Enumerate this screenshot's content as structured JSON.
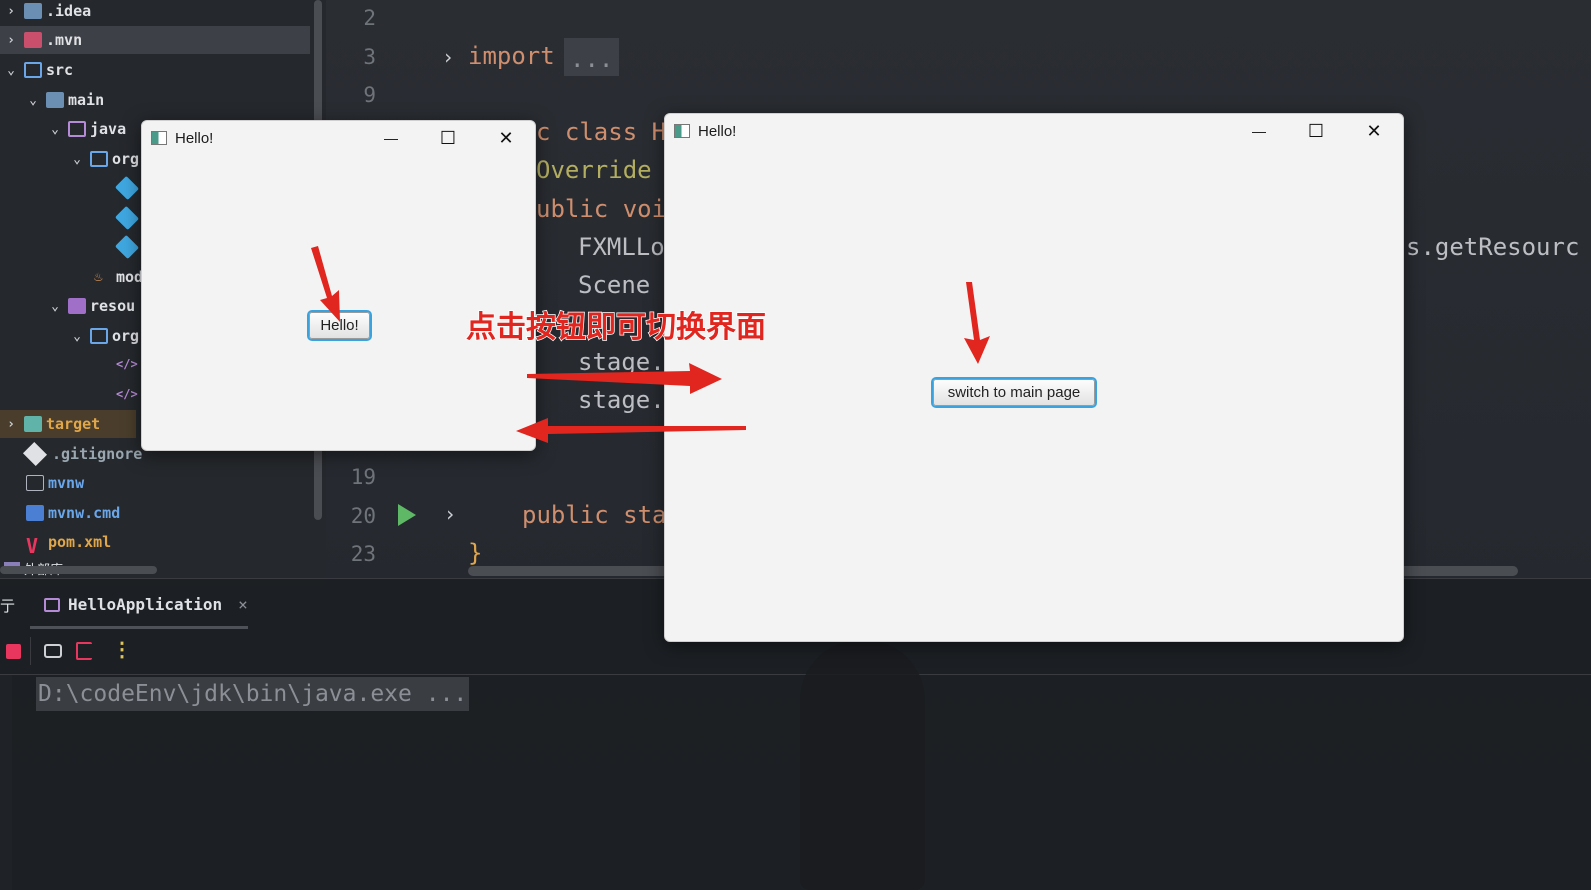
{
  "project_tree": {
    "items": [
      {
        "label": ".idea",
        "icon": "idea-folder-icon",
        "chevron": "›"
      },
      {
        "label": ".mvn",
        "icon": "mvn-folder-icon",
        "chevron": "›"
      },
      {
        "label": "src",
        "icon": "source-folder-icon",
        "chevron": "⌄"
      },
      {
        "label": "main",
        "icon": "folder-icon",
        "chevron": "⌄"
      },
      {
        "label": "java",
        "icon": "java-source-folder-icon",
        "chevron": "⌄"
      },
      {
        "label": "org",
        "icon": "package-icon",
        "chevron": "⌄"
      },
      {
        "label": "",
        "icon": "java-class-icon",
        "chevron": ""
      },
      {
        "label": "",
        "icon": "java-class-icon",
        "chevron": ""
      },
      {
        "label": "",
        "icon": "java-class-icon",
        "chevron": ""
      },
      {
        "label": "mod",
        "icon": "module-info-icon",
        "chevron": ""
      },
      {
        "label": "resou",
        "icon": "resources-folder-icon",
        "chevron": "⌄"
      },
      {
        "label": "org",
        "icon": "package-icon",
        "chevron": "⌄"
      },
      {
        "label": "",
        "icon": "fxml-file-icon",
        "chevron": ""
      },
      {
        "label": "",
        "icon": "fxml-file-icon",
        "chevron": ""
      },
      {
        "label": "target",
        "icon": "target-folder-icon",
        "chevron": "›"
      },
      {
        "label": ".gitignore",
        "icon": "git-icon",
        "chevron": ""
      },
      {
        "label": "mvnw",
        "icon": "terminal-file-icon",
        "chevron": ""
      },
      {
        "label": "mvnw.cmd",
        "icon": "powershell-file-icon",
        "chevron": ""
      },
      {
        "label": "pom.xml",
        "icon": "maven-pom-icon",
        "chevron": ""
      },
      {
        "label": "外部库",
        "icon": "library-icon",
        "chevron": ""
      }
    ]
  },
  "editor": {
    "line_numbers": [
      "2",
      "3",
      "9",
      "19",
      "20",
      "23"
    ],
    "code_lines": {
      "import_kw": "import",
      "import_fold": "...",
      "class_decl": "c class H",
      "override": "Override",
      "method_decl": "ublic voi",
      "fxml_loader": "FXMLLoa",
      "scene": "Scene",
      "stage1": "stage.",
      "stage2": "stage.",
      "get_resource": "s.getResourc",
      "main_decl": "public sta",
      "closing_brace": "}"
    }
  },
  "run_panel": {
    "left_label": "亍",
    "tab_label": "HelloApplication",
    "tab_close": "×",
    "console_output": "D:\\codeEnv\\jdk\\bin\\java.exe ..."
  },
  "window_small": {
    "title": "Hello!",
    "minimize": "—",
    "maximize": "☐",
    "close": "✕",
    "button_label": "Hello!"
  },
  "window_large": {
    "title": "Hello!",
    "minimize": "—",
    "maximize": "☐",
    "close": "✕",
    "button_label": "switch to main page"
  },
  "annotation": {
    "caption": "点击按钮即可切换界面",
    "color": "#e0261f"
  }
}
